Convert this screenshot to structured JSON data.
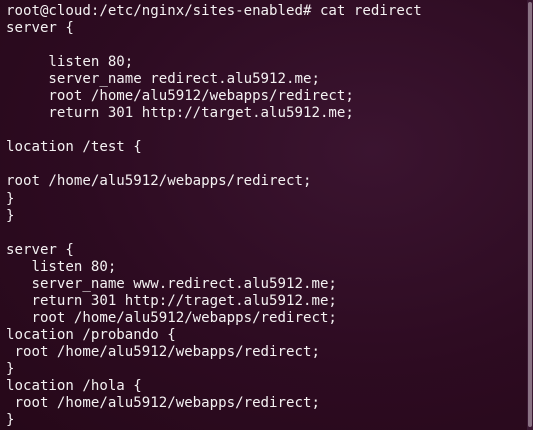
{
  "terminal": {
    "lines": [
      "root@cloud:/etc/nginx/sites-enabled# cat redirect",
      "server {",
      "",
      "     listen 80;",
      "     server_name redirect.alu5912.me;",
      "     root /home/alu5912/webapps/redirect;",
      "     return 301 http://target.alu5912.me;",
      "",
      "location /test {",
      "",
      "root /home/alu5912/webapps/redirect;",
      "}",
      "}",
      "",
      "server {",
      "   listen 80;",
      "   server_name www.redirect.alu5912.me;",
      "   return 301 http://traget.alu5912.me;",
      "   root /home/alu5912/webapps/redirect;",
      "location /probando {",
      " root /home/alu5912/webapps/redirect;",
      "}",
      "location /hola {",
      " root /home/alu5912/webapps/redirect;",
      "}"
    ]
  },
  "colors": {
    "background": "#2d0b21",
    "foreground": "#f4f1f2"
  }
}
